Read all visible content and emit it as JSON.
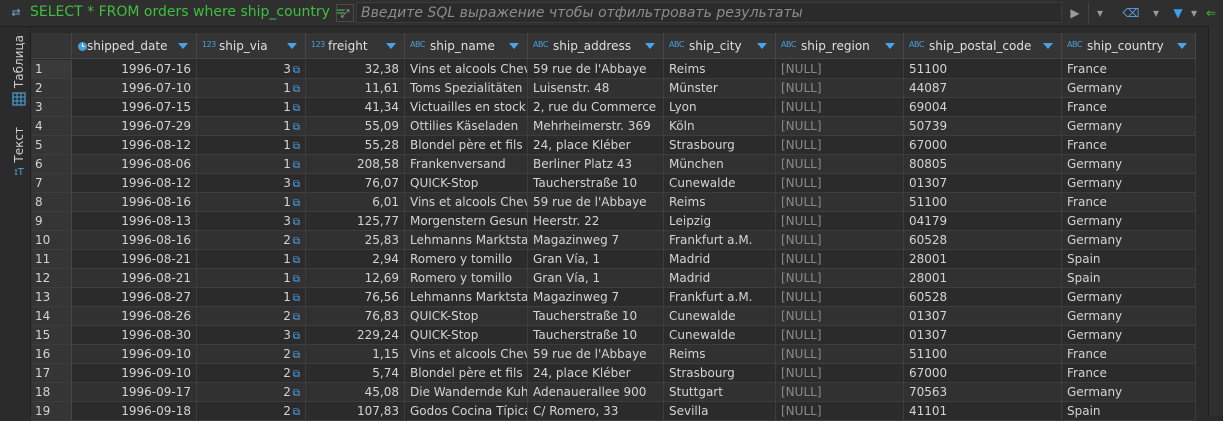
{
  "filter": {
    "sql_prefix": "SELECT * FROM orders where ship_country =",
    "placeholder": "Введите SQL выражение чтобы отфильтровать результаты"
  },
  "side_tabs": {
    "table": "Таблица",
    "text": "Текст"
  },
  "columns": [
    {
      "type": "date",
      "type_label": "",
      "name": "shipped_date"
    },
    {
      "type": "num",
      "type_label": "123",
      "name": "ship_via"
    },
    {
      "type": "num",
      "type_label": "123",
      "name": "freight"
    },
    {
      "type": "str",
      "type_label": "ABC",
      "name": "ship_name"
    },
    {
      "type": "str",
      "type_label": "ABC",
      "name": "ship_address"
    },
    {
      "type": "str",
      "type_label": "ABC",
      "name": "ship_city"
    },
    {
      "type": "str",
      "type_label": "ABC",
      "name": "ship_region"
    },
    {
      "type": "str",
      "type_label": "ABC",
      "name": "ship_postal_code"
    },
    {
      "type": "str",
      "type_label": "ABC",
      "name": "ship_country"
    }
  ],
  "rows": [
    [
      "1",
      "1996-07-16",
      "3",
      "32,38",
      "Vins et alcools Chevalier",
      "59 rue de l'Abbaye",
      "Reims",
      "[NULL]",
      "51100",
      "France"
    ],
    [
      "2",
      "1996-07-10",
      "1",
      "11,61",
      "Toms Spezialitäten",
      "Luisenstr. 48",
      "Münster",
      "[NULL]",
      "44087",
      "Germany"
    ],
    [
      "3",
      "1996-07-15",
      "1",
      "41,34",
      "Victuailles en stock",
      "2, rue du Commerce",
      "Lyon",
      "[NULL]",
      "69004",
      "France"
    ],
    [
      "4",
      "1996-07-29",
      "1",
      "55,09",
      "Ottilies Käseladen",
      "Mehrheimerstr. 369",
      "Köln",
      "[NULL]",
      "50739",
      "Germany"
    ],
    [
      "5",
      "1996-08-12",
      "1",
      "55,28",
      "Blondel père et fils",
      "24, place Kléber",
      "Strasbourg",
      "[NULL]",
      "67000",
      "France"
    ],
    [
      "6",
      "1996-08-06",
      "1",
      "208,58",
      "Frankenversand",
      "Berliner Platz 43",
      "München",
      "[NULL]",
      "80805",
      "Germany"
    ],
    [
      "7",
      "1996-08-12",
      "3",
      "76,07",
      "QUICK-Stop",
      "Taucherstraße 10",
      "Cunewalde",
      "[NULL]",
      "01307",
      "Germany"
    ],
    [
      "8",
      "1996-08-16",
      "1",
      "6,01",
      "Vins et alcools Chevalier",
      "59 rue de l'Abbaye",
      "Reims",
      "[NULL]",
      "51100",
      "France"
    ],
    [
      "9",
      "1996-08-13",
      "3",
      "125,77",
      "Morgenstern Gesundkost",
      "Heerstr. 22",
      "Leipzig",
      "[NULL]",
      "04179",
      "Germany"
    ],
    [
      "10",
      "1996-08-16",
      "2",
      "25,83",
      "Lehmanns Marktstand",
      "Magazinweg 7",
      "Frankfurt a.M.",
      "[NULL]",
      "60528",
      "Germany"
    ],
    [
      "11",
      "1996-08-21",
      "1",
      "2,94",
      "Romero y tomillo",
      "Gran Vía, 1",
      "Madrid",
      "[NULL]",
      "28001",
      "Spain"
    ],
    [
      "12",
      "1996-08-21",
      "1",
      "12,69",
      "Romero y tomillo",
      "Gran Vía, 1",
      "Madrid",
      "[NULL]",
      "28001",
      "Spain"
    ],
    [
      "13",
      "1996-08-27",
      "1",
      "76,56",
      "Lehmanns Marktstand",
      "Magazinweg 7",
      "Frankfurt a.M.",
      "[NULL]",
      "60528",
      "Germany"
    ],
    [
      "14",
      "1996-08-26",
      "2",
      "76,83",
      "QUICK-Stop",
      "Taucherstraße 10",
      "Cunewalde",
      "[NULL]",
      "01307",
      "Germany"
    ],
    [
      "15",
      "1996-08-30",
      "3",
      "229,24",
      "QUICK-Stop",
      "Taucherstraße 10",
      "Cunewalde",
      "[NULL]",
      "01307",
      "Germany"
    ],
    [
      "16",
      "1996-09-10",
      "2",
      "1,15",
      "Vins et alcools Chevalier",
      "59 rue de l'Abbaye",
      "Reims",
      "[NULL]",
      "51100",
      "France"
    ],
    [
      "17",
      "1996-09-10",
      "2",
      "5,74",
      "Blondel père et fils",
      "24, place Kléber",
      "Strasbourg",
      "[NULL]",
      "67000",
      "France"
    ],
    [
      "18",
      "1996-09-17",
      "2",
      "45,08",
      "Die Wandernde Kuh",
      "Adenauerallee 900",
      "Stuttgart",
      "[NULL]",
      "70563",
      "Germany"
    ],
    [
      "19",
      "1996-09-18",
      "2",
      "107,83",
      "Godos Cocina Típica",
      "C/ Romero, 33",
      "Sevilla",
      "[NULL]",
      "41101",
      "Spain"
    ]
  ]
}
